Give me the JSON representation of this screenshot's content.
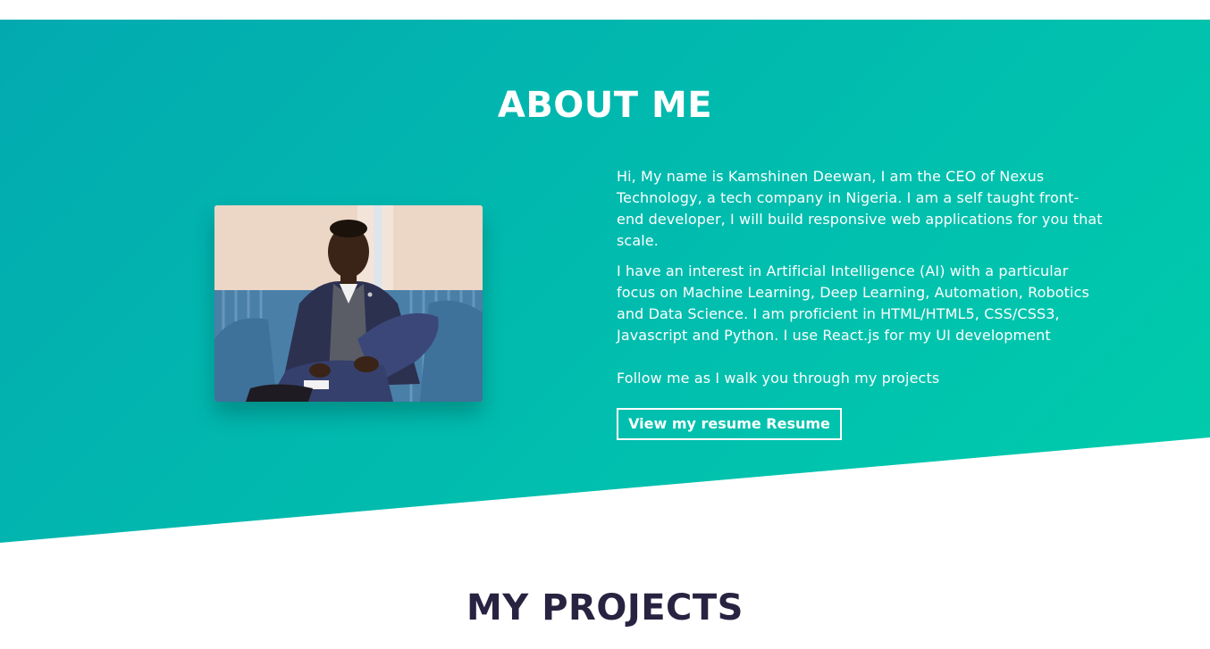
{
  "about": {
    "title": "ABOUT ME",
    "paragraphs": [
      "Hi, My name is Kamshinen Deewan, I am the CEO of Nexus Technology, a tech company in Nigeria. I am a self taught front-end developer, I will build responsive web applications for you that scale.",
      "I have an interest in Artificial Intelligence (AI) with a particular focus on Machine Learning, Deep Learning, Automation, Robotics and Data Science. I am proficient in HTML/HTML5, CSS/CSS3, Javascript and Python. I use React.js for my UI development",
      "Follow me as I walk you through my projects"
    ],
    "resume_button": "View my resume Resume",
    "photo_alt": "profile photo"
  },
  "projects": {
    "title": "MY PROJECTS"
  },
  "colors": {
    "gradient_start": "#02aab0",
    "gradient_end": "#00cdac",
    "heading_dark": "#272341",
    "text_light": "#ffffff"
  }
}
